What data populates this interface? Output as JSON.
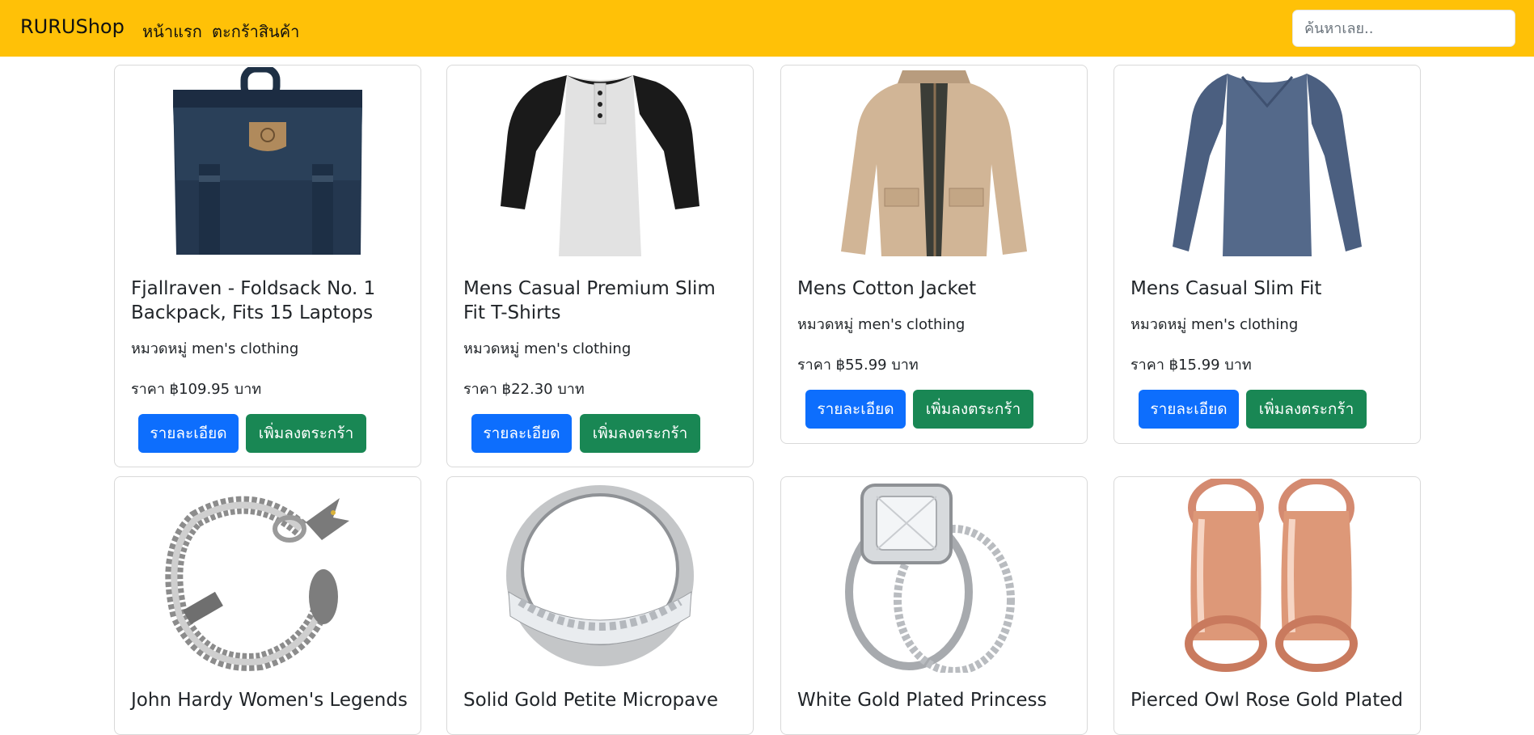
{
  "nav": {
    "brand": "RURUShop",
    "links": [
      "หน้าแรก",
      "ตะกร้าสินค้า"
    ],
    "search_placeholder": "ค้นหาเลย.."
  },
  "products": [
    {
      "title": "Fjallraven - Foldsack No. 1 Backpack, Fits 15 Laptops",
      "category": "หมวดหมู่ men's clothing",
      "price": "ราคา ฿109.95 บาท",
      "detail_label": "รายละเอียด",
      "add_label": "เพิ่มลงตระกร้า",
      "image": "backpack-image"
    },
    {
      "title": "Mens Casual Premium Slim Fit T-Shirts",
      "category": "หมวดหมู่ men's clothing",
      "price": "ราคา ฿22.30 บาท",
      "detail_label": "รายละเอียด",
      "add_label": "เพิ่มลงตระกร้า",
      "image": "raglan-tshirt-image"
    },
    {
      "title": "Mens Cotton Jacket",
      "category": "หมวดหมู่ men's clothing",
      "price": "ราคา ฿55.99 บาท",
      "detail_label": "รายละเอียด",
      "add_label": "เพิ่มลงตระกร้า",
      "image": "cotton-jacket-image"
    },
    {
      "title": "Mens Casual Slim Fit",
      "category": "หมวดหมู่ men's clothing",
      "price": "ราคา ฿15.99 บาท",
      "detail_label": "รายละเอียด",
      "add_label": "เพิ่มลงตระกร้า",
      "image": "long-sleeve-shirt-image"
    },
    {
      "title": "John Hardy Women's Legends",
      "image": "dragon-bracelet-image"
    },
    {
      "title": "Solid Gold Petite Micropave",
      "image": "silver-ring-image"
    },
    {
      "title": "White Gold Plated Princess",
      "image": "princess-ring-set-image"
    },
    {
      "title": "Pierced Owl Rose Gold Plated",
      "image": "rose-gold-plugs-image"
    }
  ],
  "colors": {
    "navbar": "#ffc107",
    "detail_button": "#0d6efd",
    "add_button": "#198754"
  }
}
